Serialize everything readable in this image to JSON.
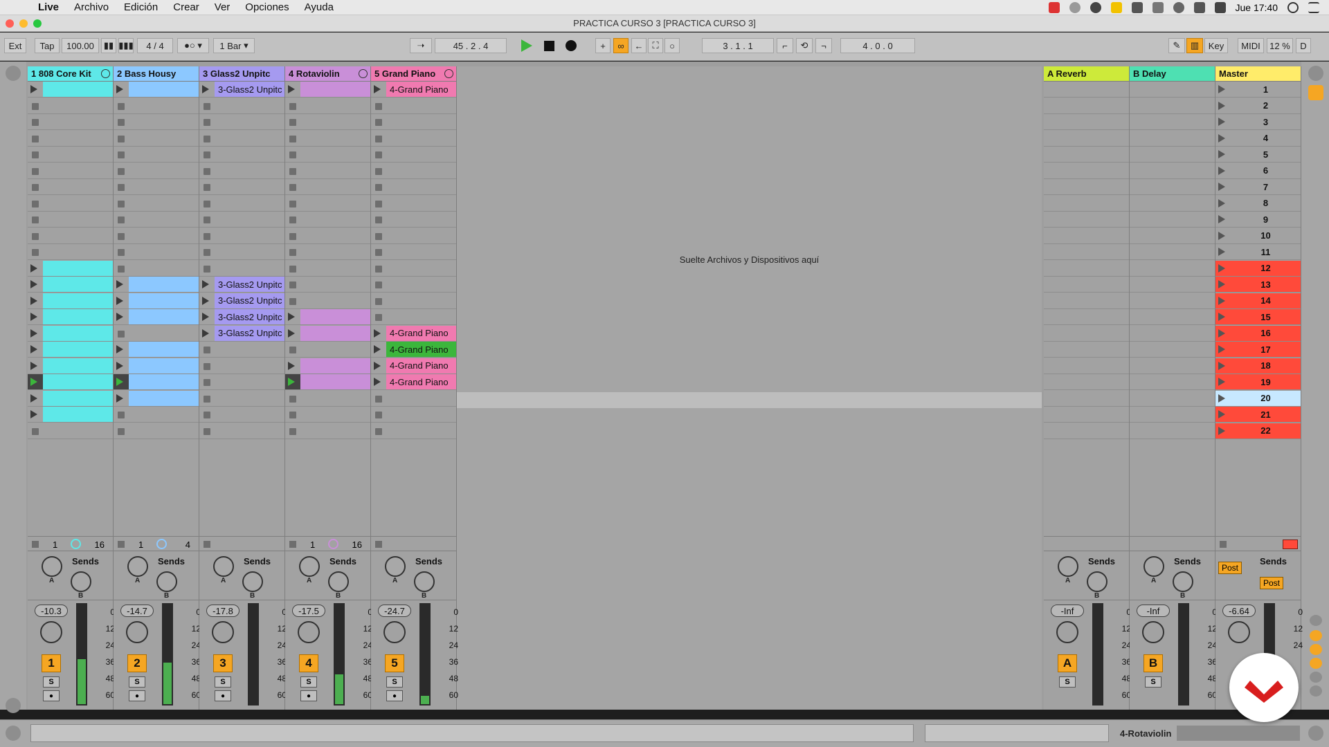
{
  "menubar": {
    "app": "Live",
    "items": [
      "Archivo",
      "Edición",
      "Crear",
      "Ver",
      "Opciones",
      "Ayuda"
    ],
    "clock": "Jue 17:40"
  },
  "title": "PRACTICA CURSO 3  [PRACTICA CURSO 3]",
  "toolbar": {
    "ext": "Ext",
    "tap": "Tap",
    "tempo": "100.00",
    "sig_num": "4",
    "sig_sep": "/",
    "sig_den": "4",
    "quant": "1 Bar",
    "position": "45 .  2 .  4",
    "loop_start": "3 .  1 .  1",
    "loop_len": "4 .  0 .  0",
    "key": "Key",
    "midi": "MIDI",
    "cpu": "12 %",
    "d": "D"
  },
  "tracks": [
    {
      "name": "1 808 Core Kit",
      "color": "#5ee8e8",
      "num": "1",
      "vol": "-10.3",
      "stop_a": "1",
      "stop_b": "16",
      "meter": 0.45
    },
    {
      "name": "2 Bass Housy",
      "color": "#8cc8ff",
      "num": "2",
      "vol": "-14.7",
      "stop_a": "1",
      "stop_b": "4",
      "meter": 0.42
    },
    {
      "name": "3 Glass2 Unpitc",
      "color": "#a59af0",
      "num": "3",
      "vol": "-17.8",
      "stop_a": "",
      "stop_b": "",
      "meter": 0.0
    },
    {
      "name": "4 Rotaviolin",
      "color": "#c98fd8",
      "num": "4",
      "vol": "-17.5",
      "stop_a": "1",
      "stop_b": "16",
      "meter": 0.3
    },
    {
      "name": "5 Grand Piano",
      "color": "#f07ab0",
      "num": "5",
      "vol": "-24.7",
      "stop_a": "",
      "stop_b": "",
      "meter": 0.08
    }
  ],
  "returns": [
    {
      "name": "A Reverb",
      "color": "#cdea3a",
      "num": "A",
      "vol": "-Inf"
    },
    {
      "name": "B Delay",
      "color": "#4ee0b2",
      "num": "B",
      "vol": "-Inf"
    }
  ],
  "master": {
    "name": "Master",
    "color": "#ffec6a",
    "vol": "-6.64",
    "post1": "Post",
    "post2": "Post",
    "scenes": [
      "1",
      "2",
      "3",
      "4",
      "5",
      "6",
      "7",
      "8",
      "9",
      "10",
      "11",
      "12",
      "13",
      "14",
      "15",
      "16",
      "17",
      "18",
      "19",
      "20",
      "21",
      "22"
    ]
  },
  "clip_label_glass": "3-Glass2 Unpitc",
  "clip_label_piano": "4-Grand Piano",
  "sends_label": "Sends",
  "solo_label": "S",
  "knob_a": "A",
  "knob_b": "B",
  "scale": [
    "0",
    "12",
    "24",
    "36",
    "48",
    "60"
  ],
  "drop_text": "Suelte Archivos y Dispositivos aquí",
  "status": {
    "selected": "4-Rotaviolin"
  },
  "colors": {
    "scene_red": "#ff4a3a",
    "scene_sel": "#c7e8ff",
    "play_green": "#3cb63c"
  }
}
